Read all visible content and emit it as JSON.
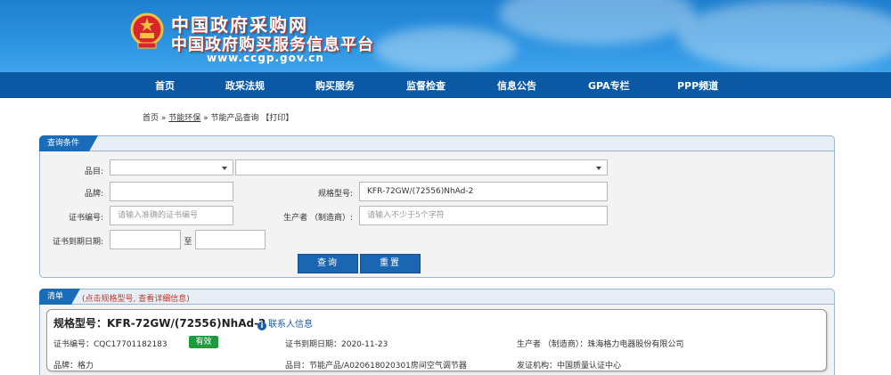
{
  "header": {
    "title_main": "中国政府采购网",
    "title_sub": "中国政府购买服务信息平台",
    "url": "www.ccgp.gov.cn",
    "emblem_icon": "national-emblem-icon"
  },
  "nav": {
    "items": [
      "首页",
      "政采法规",
      "购买服务",
      "监督检查",
      "信息公告",
      "GPA专栏",
      "PPP频道"
    ]
  },
  "breadcrumb": {
    "home": "首页",
    "sep1": " » ",
    "category": "节能环保",
    "sep2": " » ",
    "current": "节能产品查询",
    "print": " 【打印】"
  },
  "query_panel": {
    "tab_label": "查询条件",
    "category_label": "品目:",
    "brand_label": "品牌:",
    "model_label": "规格型号:",
    "model_value": "KFR-72GW/(72556)NhAd-2",
    "cert_label": "证书编号:",
    "cert_placeholder": "请输入准确的证书编号",
    "producer_label": "生产者 （制造商）:",
    "producer_placeholder": "请输入不少于5个字符",
    "expiry_label": "证书到期日期:",
    "to_label": "至",
    "search_button": "查询",
    "reset_button": "重置"
  },
  "list_panel": {
    "tab_label": "清单",
    "hint": "(点击规格型号, 查看详细信息)",
    "result": {
      "title": "规格型号：KFR-72GW/(72556)NhAd-2",
      "contact_label": "联系人信息",
      "cert_no": "证书编号：CQC17701182183",
      "status": "有效",
      "expiry": "证书到期日期：2020-11-23",
      "producer": "生产者 （制造商）：珠海格力电器股份有限公司",
      "brand": "品牌：格力",
      "category": "品目：节能产品/A020618020301房间空气调节器",
      "issuer": "发证机构：中国质量认证中心"
    }
  },
  "colors": {
    "header_blue": "#2b92e0",
    "nav_blue": "#0b59a4",
    "button_blue": "#1b66b2",
    "status_green": "#1f9a3c",
    "hint_red": "#c0392b"
  }
}
